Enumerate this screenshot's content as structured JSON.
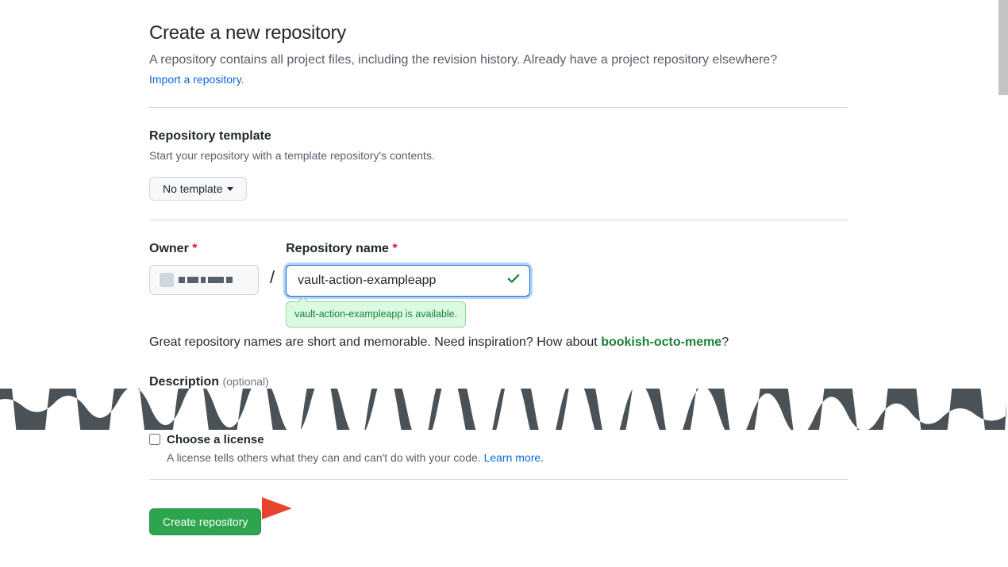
{
  "header": {
    "title": "Create a new repository",
    "subhead": "A repository contains all project files, including the revision history. Already have a project repository elsewhere?",
    "import_link": "Import a repository."
  },
  "template": {
    "title": "Repository template",
    "note": "Start your repository with a template repository's contents.",
    "button_label": "No template"
  },
  "owner_label": "Owner",
  "repo_name_label": "Repository name",
  "repo_name_value": "vault-action-exampleapp",
  "availability_msg": "vault-action-exampleapp is available.",
  "suggestion": {
    "prefix": "Great repository names are short and memorable. Need inspiration? How about ",
    "suggested": "bookish-octo-meme",
    "suffix": "?"
  },
  "description": {
    "label": "Description",
    "optional": "(optional)"
  },
  "license": {
    "title": "Choose a license",
    "note_prefix": "A license tells others what they can and can't do with your code. ",
    "learn_more": "Learn more."
  },
  "create_button": "Create repository"
}
